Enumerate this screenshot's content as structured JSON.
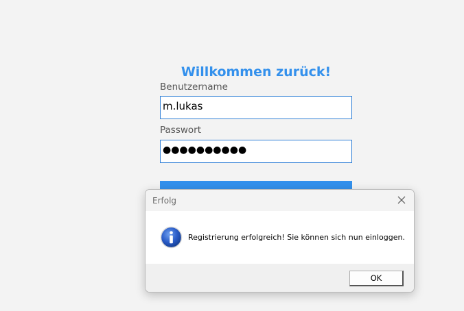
{
  "login": {
    "title": "Willkommen zurück!",
    "username_label": "Benutzername",
    "username_value": "m.lukas",
    "password_label": "Passwort",
    "password_masked": "●●●●●●●●●●"
  },
  "dialog": {
    "title": "Erfolg",
    "message": "Registrierung erfolgreich! Sie können sich nun einloggen.",
    "ok_label": "OK",
    "icon": "info-icon",
    "close_icon": "close-icon"
  },
  "colors": {
    "accent": "#3390ec",
    "background": "#f3f3f3"
  }
}
